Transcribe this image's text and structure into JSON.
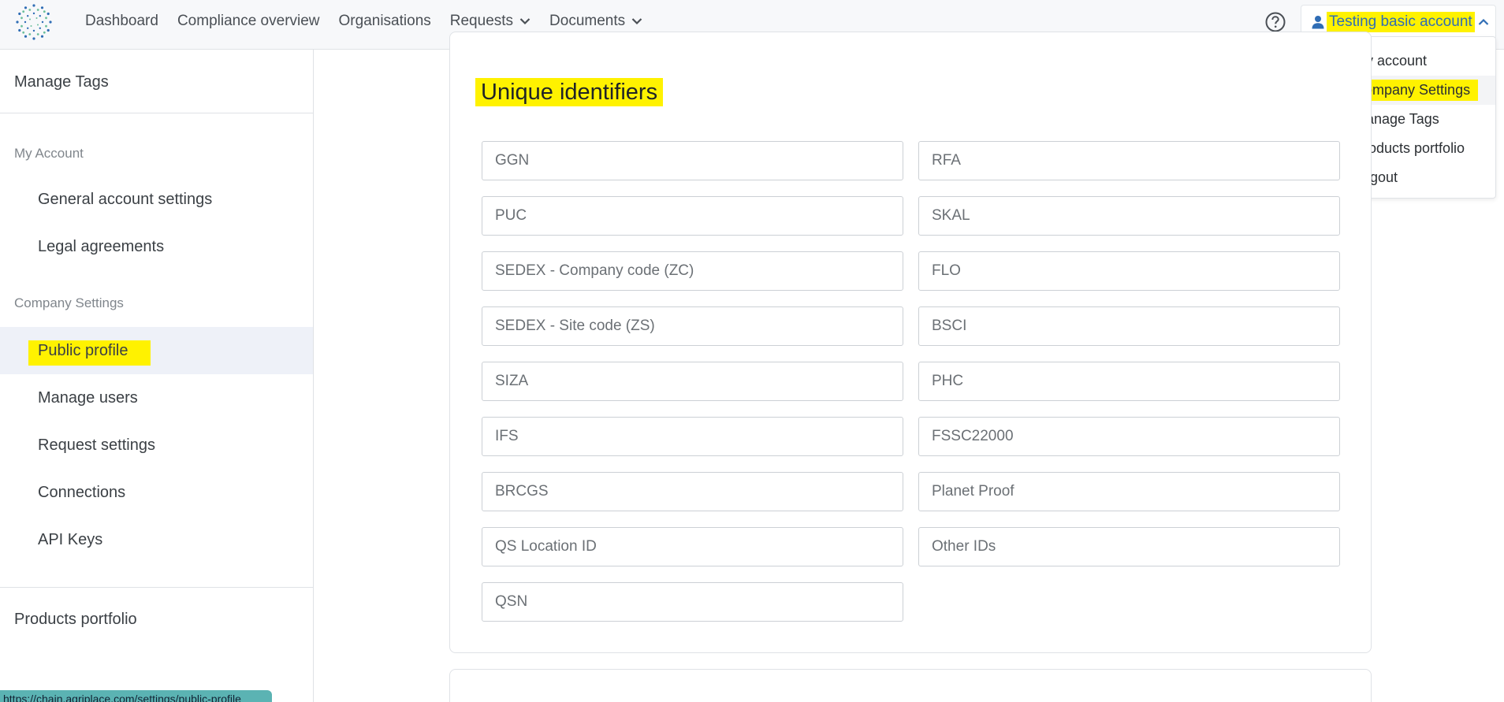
{
  "nav": {
    "items": [
      {
        "label": "Dashboard"
      },
      {
        "label": "Compliance overview"
      },
      {
        "label": "Organisations"
      },
      {
        "label": "Requests"
      },
      {
        "label": "Documents"
      }
    ]
  },
  "account": {
    "label": "Testing basic account",
    "menu": [
      {
        "label": "My account"
      },
      {
        "label": "Company Settings"
      },
      {
        "label": "Manage Tags"
      },
      {
        "label": "Products portfolio"
      },
      {
        "label": "Logout"
      }
    ]
  },
  "sidebar": {
    "top_item": "Manage Tags",
    "sections": [
      {
        "title": "My Account",
        "items": [
          "General account settings",
          "Legal agreements"
        ]
      },
      {
        "title": "Company Settings",
        "items": [
          "Public profile",
          "Manage users",
          "Request settings",
          "Connections",
          "API Keys"
        ]
      }
    ],
    "bottom_item": "Products portfolio"
  },
  "status_url": "https://chain.agriplace.com/settings/public-profile",
  "identifiers": {
    "title": "Unique identifiers",
    "fields": {
      "ggn": {
        "placeholder": "GGN"
      },
      "rfa": {
        "placeholder": "RFA"
      },
      "puc": {
        "placeholder": "PUC"
      },
      "skal": {
        "placeholder": "SKAL"
      },
      "sedex_zc": {
        "placeholder": "SEDEX - Company code (ZC)"
      },
      "flo": {
        "placeholder": "FLO"
      },
      "sedex_zs": {
        "placeholder": "SEDEX - Site code (ZS)"
      },
      "bsci": {
        "placeholder": "BSCI"
      },
      "siza": {
        "placeholder": "SIZA"
      },
      "phc": {
        "placeholder": "PHC"
      },
      "ifs": {
        "placeholder": "IFS"
      },
      "fssc": {
        "placeholder": "FSSC22000"
      },
      "brcgs": {
        "placeholder": "BRCGS"
      },
      "planet_proof": {
        "placeholder": "Planet Proof"
      },
      "qs_location": {
        "placeholder": "QS Location ID"
      },
      "other_ids": {
        "placeholder": "Other IDs"
      },
      "qsn": {
        "placeholder": "QSN"
      }
    }
  },
  "colors": {
    "highlight": "#fff200",
    "account_text": "#2f6db5",
    "active_row": "#eef1f8"
  },
  "icons": [
    "app-logo-icon",
    "chevron-down-icon",
    "help-icon",
    "user-icon",
    "chevron-up-icon"
  ]
}
